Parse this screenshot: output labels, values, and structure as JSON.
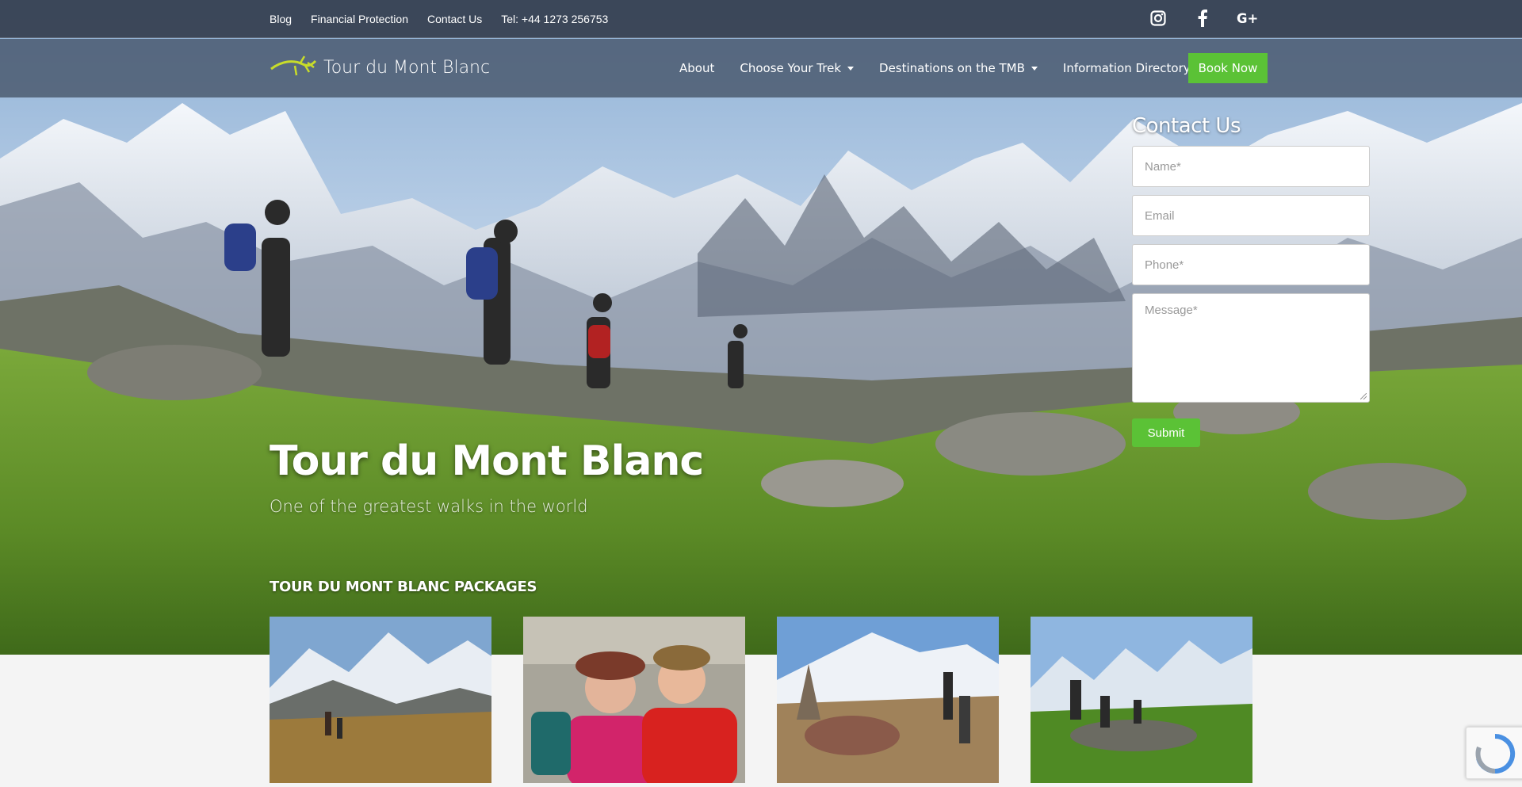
{
  "topbar": {
    "links": [
      "Blog",
      "Financial Protection",
      "Contact Us",
      "Tel: +44 1273 256753"
    ],
    "social": [
      {
        "icon": "instagram-icon"
      },
      {
        "icon": "facebook-icon"
      },
      {
        "icon": "google-plus-icon"
      }
    ]
  },
  "brand": {
    "name": "Tour du Mont Blanc",
    "logo_color": "#c8dc2a"
  },
  "nav": {
    "items": [
      {
        "label": "About",
        "dropdown": false
      },
      {
        "label": "Choose Your Trek",
        "dropdown": true
      },
      {
        "label": "Destinations on the TMB",
        "dropdown": true
      },
      {
        "label": "Information Directory",
        "dropdown": true
      }
    ],
    "book_label": "Book Now"
  },
  "contact": {
    "title": "Contact Us",
    "name_placeholder": "Name*",
    "email_placeholder": "Email",
    "phone_placeholder": "Phone*",
    "message_placeholder": "Message*",
    "submit_label": "Submit"
  },
  "hero": {
    "title": "Tour du Mont Blanc",
    "subtitle": "One of the greatest walks in the world"
  },
  "packages": {
    "title": "TOUR DU MONT BLANC PACKAGES"
  },
  "colors": {
    "accent": "#5bc236",
    "topbar": "#343e4e"
  }
}
